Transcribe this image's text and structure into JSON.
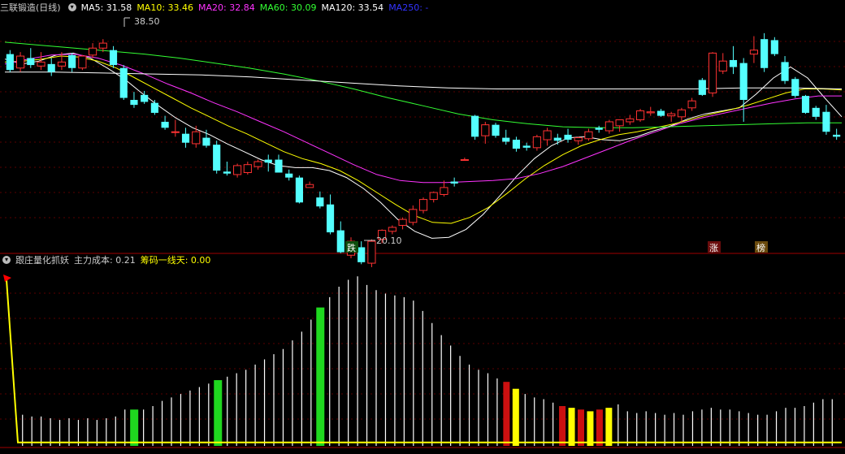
{
  "header_top": {
    "title": "三联锻造(日线)",
    "ma": [
      {
        "label": "MA5: 31.58",
        "color": "#ffffff"
      },
      {
        "label": "MA10: 33.46",
        "color": "#ffff00"
      },
      {
        "label": "MA20: 32.84",
        "color": "#ff33ff"
      },
      {
        "label": "MA60: 30.09",
        "color": "#33ff33"
      },
      {
        "label": "MA120: 33.54",
        "color": "#ffffff"
      },
      {
        "label": "MA250: -",
        "color": "#3333ff"
      }
    ]
  },
  "header_bottom": {
    "title": "跟庄量化抓妖",
    "cost_label": "主力成本: 0.21",
    "chip_label": "筹码一线天: 0.00",
    "chip_color": "#ffff00"
  },
  "annotations": {
    "high_label": "38.50",
    "low_label": "20.10",
    "tag_fall": "跌",
    "tag_rise": "涨",
    "tag_rank": "榜"
  },
  "chart_data": {
    "type": "candlestick",
    "ylim": [
      17.8,
      40.8
    ],
    "ohlc": [
      [
        37.0,
        37.4,
        35.2,
        35.4
      ],
      [
        35.6,
        37.2,
        35.2,
        36.8
      ],
      [
        36.6,
        37.6,
        35.6,
        35.9
      ],
      [
        35.8,
        37.2,
        35.4,
        36.2
      ],
      [
        36.0,
        36.6,
        34.8,
        35.2
      ],
      [
        35.8,
        37.2,
        35.4,
        36.2
      ],
      [
        36.9,
        37.1,
        35.2,
        35.6
      ],
      [
        35.6,
        36.9,
        35.4,
        36.8
      ],
      [
        36.9,
        38.1,
        36.6,
        37.6
      ],
      [
        37.6,
        38.5,
        37.2,
        38.1
      ],
      [
        37.4,
        37.8,
        35.6,
        35.9
      ],
      [
        35.6,
        35.9,
        32.4,
        32.6
      ],
      [
        32.4,
        33.2,
        31.6,
        31.9
      ],
      [
        32.9,
        33.3,
        32.0,
        32.2
      ],
      [
        32.1,
        32.4,
        30.9,
        31.1
      ],
      [
        30.2,
        30.8,
        29.4,
        29.6
      ],
      [
        29.2,
        30.4,
        28.7,
        29.2
      ],
      [
        29.0,
        29.6,
        27.6,
        28.1
      ],
      [
        28.0,
        29.8,
        27.6,
        29.2
      ],
      [
        28.6,
        29.4,
        27.6,
        27.8
      ],
      [
        27.9,
        28.3,
        25.0,
        25.3
      ],
      [
        25.2,
        26.2,
        24.8,
        25.0
      ],
      [
        24.9,
        26.0,
        24.6,
        25.8
      ],
      [
        25.1,
        26.2,
        24.9,
        25.9
      ],
      [
        25.7,
        26.4,
        25.4,
        26.2
      ],
      [
        26.4,
        26.9,
        25.2,
        26.1
      ],
      [
        26.4,
        26.9,
        25.2,
        25.1
      ],
      [
        25.0,
        25.4,
        24.3,
        24.6
      ],
      [
        24.6,
        24.8,
        22.0,
        22.1
      ],
      [
        23.6,
        24.2,
        23.6,
        23.9
      ],
      [
        22.6,
        23.2,
        21.5,
        21.7
      ],
      [
        21.9,
        22.9,
        18.9,
        19.1
      ],
      [
        19.3,
        20.2,
        17.0,
        17.1
      ],
      [
        16.8,
        18.6,
        16.5,
        18.2
      ],
      [
        17.6,
        18.2,
        15.9,
        16.1
      ],
      [
        16.0,
        18.4,
        15.6,
        18.2
      ],
      [
        18.4,
        19.4,
        18.0,
        19.3
      ],
      [
        19.2,
        19.8,
        18.9,
        19.6
      ],
      [
        19.8,
        20.6,
        19.4,
        20.4
      ],
      [
        20.1,
        21.8,
        19.8,
        21.4
      ],
      [
        21.3,
        22.6,
        21.0,
        22.4
      ],
      [
        22.4,
        23.2,
        22.1,
        23.1
      ],
      [
        22.9,
        24.3,
        22.7,
        23.6
      ],
      [
        24.2,
        24.6,
        23.7,
        24.0
      ],
      [
        26.4,
        26.6,
        26.4,
        26.4
      ],
      [
        30.8,
        30.9,
        28.4,
        28.7
      ],
      [
        28.8,
        30.2,
        28.0,
        29.9
      ],
      [
        29.9,
        30.1,
        28.6,
        28.8
      ],
      [
        28.6,
        29.4,
        27.9,
        28.2
      ],
      [
        28.4,
        28.7,
        27.2,
        27.5
      ],
      [
        27.8,
        28.1,
        27.3,
        27.6
      ],
      [
        27.6,
        28.9,
        27.3,
        28.7
      ],
      [
        28.4,
        29.6,
        27.8,
        29.3
      ],
      [
        28.6,
        29.0,
        27.9,
        28.3
      ],
      [
        28.9,
        29.5,
        28.1,
        28.4
      ],
      [
        28.3,
        28.7,
        27.9,
        28.6
      ],
      [
        28.5,
        29.5,
        28.3,
        29.2
      ],
      [
        29.6,
        29.8,
        29.1,
        29.4
      ],
      [
        29.3,
        30.4,
        29.0,
        30.2
      ],
      [
        29.8,
        30.4,
        29.2,
        30.4
      ],
      [
        30.2,
        30.9,
        29.9,
        30.5
      ],
      [
        30.4,
        31.5,
        30.2,
        31.3
      ],
      [
        31.1,
        31.7,
        30.8,
        31.2
      ],
      [
        31.3,
        31.5,
        30.7,
        30.8
      ],
      [
        30.8,
        31.2,
        30.2,
        31.0
      ],
      [
        30.7,
        31.6,
        30.2,
        31.4
      ],
      [
        31.6,
        32.6,
        31.3,
        32.3
      ],
      [
        34.4,
        34.6,
        32.8,
        32.9
      ],
      [
        33.1,
        37.2,
        32.7,
        37.1
      ],
      [
        35.3,
        37.1,
        35.0,
        36.3
      ],
      [
        36.4,
        37.8,
        35.0,
        35.7
      ],
      [
        36.1,
        36.6,
        30.2,
        32.4
      ],
      [
        37.0,
        38.8,
        36.1,
        37.4
      ],
      [
        38.5,
        39.1,
        35.2,
        35.6
      ],
      [
        38.4,
        38.7,
        36.8,
        37.0
      ],
      [
        36.2,
        36.8,
        34.0,
        34.3
      ],
      [
        34.5,
        34.7,
        32.6,
        32.8
      ],
      [
        32.8,
        32.9,
        31.0,
        31.1
      ],
      [
        31.6,
        31.8,
        30.4,
        30.7
      ],
      [
        31.2,
        31.9,
        28.9,
        29.2
      ],
      [
        28.9,
        29.5,
        28.4,
        28.7
      ]
    ],
    "ma_series": [
      {
        "name": "MA5",
        "color": "#ffffff",
        "values": [
          36.5,
          36.0,
          36.3,
          36.9,
          37.1,
          36.6,
          35.6,
          34.5,
          33.1,
          31.8,
          30.6,
          29.6,
          28.9,
          28.0,
          27.2,
          26.4,
          25.8,
          25.6,
          25.6,
          25.3,
          24.6,
          23.5,
          22.1,
          20.4,
          19.2,
          18.5,
          18.6,
          19.4,
          20.9,
          22.8,
          24.8,
          26.5,
          27.8,
          28.6,
          28.7,
          28.4,
          28.3,
          28.7,
          29.3,
          29.8,
          30.5,
          31.0,
          31.3,
          31.6,
          33.0,
          34.6,
          35.7,
          34.6,
          32.6,
          30.7
        ]
      },
      {
        "name": "MA10",
        "color": "#ffff00",
        "values": [
          36.2,
          36.3,
          36.5,
          36.8,
          36.7,
          36.3,
          35.6,
          34.6,
          33.6,
          32.6,
          31.6,
          30.7,
          29.8,
          29.0,
          28.1,
          27.2,
          26.5,
          26.0,
          25.3,
          24.3,
          23.1,
          21.9,
          20.8,
          20.1,
          20.0,
          20.6,
          21.6,
          23.0,
          24.5,
          25.8,
          26.9,
          27.8,
          28.4,
          28.9,
          29.2,
          29.6,
          30.0,
          30.5,
          31.0,
          31.4,
          31.9,
          32.5,
          33.1,
          33.5,
          33.5,
          33.4
        ]
      },
      {
        "name": "MA20",
        "color": "#ff33ff",
        "values": [
          36.0,
          36.5,
          36.9,
          37.0,
          36.6,
          35.9,
          35.0,
          34.0,
          33.1,
          32.1,
          31.2,
          30.2,
          29.2,
          28.1,
          27.0,
          25.9,
          24.9,
          24.3,
          24.1,
          24.1,
          24.2,
          24.3,
          24.5,
          25.0,
          25.7,
          26.6,
          27.5,
          28.4,
          29.2,
          30.0,
          30.6,
          31.1,
          31.6,
          32.1,
          32.5,
          32.8,
          32.8
        ]
      },
      {
        "name": "MA60",
        "color": "#33ff33",
        "values": [
          38.2,
          37.9,
          37.6,
          37.3,
          37.0,
          36.6,
          36.1,
          35.6,
          35.0,
          34.3,
          33.5,
          32.6,
          31.8,
          31.0,
          30.4,
          30.0,
          29.7,
          29.6,
          29.6,
          29.7,
          29.8,
          29.9,
          30.0,
          30.1,
          30.1
        ]
      },
      {
        "name": "MA120",
        "color": "#ffffff",
        "values": [
          35.2,
          35.2,
          35.1,
          35.0,
          34.9,
          34.7,
          34.4,
          34.1,
          33.8,
          33.6,
          33.5,
          33.5,
          33.5,
          33.5,
          33.5,
          33.6,
          33.6,
          33.5
        ]
      }
    ],
    "indicator": {
      "name": "跟庄量化抓妖",
      "ylim": [
        0,
        1
      ],
      "values": [
        0.18,
        0.17,
        0.17,
        0.16,
        0.15,
        0.16,
        0.15,
        0.16,
        0.15,
        0.16,
        0.17,
        0.21,
        0.21,
        0.21,
        0.23,
        0.26,
        0.28,
        0.3,
        0.32,
        0.34,
        0.36,
        0.38,
        0.4,
        0.42,
        0.44,
        0.47,
        0.5,
        0.53,
        0.56,
        0.61,
        0.66,
        0.73,
        0.8,
        0.86,
        0.92,
        0.96,
        0.98,
        0.93,
        0.9,
        0.88,
        0.87,
        0.86,
        0.84,
        0.78,
        0.71,
        0.64,
        0.58,
        0.52,
        0.47,
        0.44,
        0.42,
        0.39,
        0.37,
        0.33,
        0.3,
        0.28,
        0.27,
        0.25,
        0.23,
        0.22,
        0.21,
        0.2,
        0.21,
        0.22,
        0.24,
        0.2,
        0.19,
        0.2,
        0.19,
        0.18,
        0.19,
        0.18,
        0.2,
        0.21,
        0.22,
        0.21,
        0.21,
        0.2,
        0.19,
        0.18,
        0.18,
        0.2,
        0.22,
        0.22,
        0.23,
        0.25,
        0.27,
        0.27
      ],
      "highlight": {
        "green": [
          12,
          21,
          32
        ],
        "red": [
          52,
          58,
          60,
          62
        ],
        "yellow": [
          53,
          59,
          61,
          63
        ]
      },
      "line": {
        "color": "#ffff00",
        "start": 0.96,
        "end": 0.02
      }
    }
  }
}
